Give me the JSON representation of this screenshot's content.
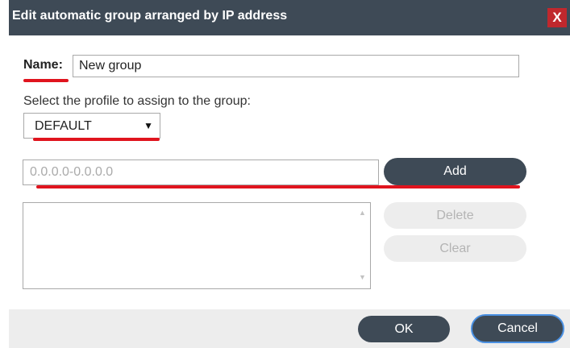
{
  "dialog": {
    "title": "Edit automatic group arranged by IP address",
    "close_label": "X"
  },
  "name_field": {
    "label": "Name:",
    "value": "New group"
  },
  "profile": {
    "label": "Select the profile to assign to the group:",
    "selected": "DEFAULT",
    "arrow": "▼"
  },
  "ip_range": {
    "placeholder": "0.0.0.0-0.0.0.0",
    "add_label": "Add"
  },
  "list_actions": {
    "delete_label": "Delete",
    "clear_label": "Clear",
    "scroll_up": "▲",
    "scroll_down": "▼"
  },
  "footer": {
    "ok_label": "OK",
    "cancel_label": "Cancel"
  },
  "colors": {
    "titlebar": "#3e4a56",
    "close": "#c0282d",
    "highlight": "#e0141e",
    "focus_ring": "#4a90e2"
  }
}
